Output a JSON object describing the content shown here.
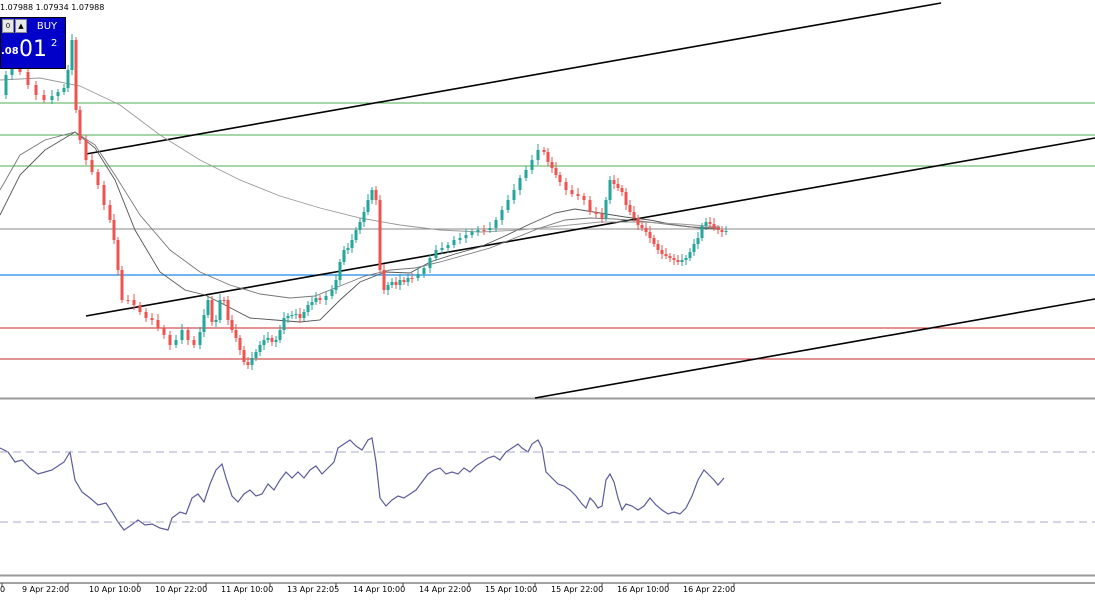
{
  "header": {
    "ohlc": "1.07988 1.07934 1.07988"
  },
  "trade_panel": {
    "small_button_left": "0",
    "small_button_right": "▲",
    "buy_label": "BUY",
    "price_prefix": ".08",
    "price_big": "01",
    "price_sup": "2"
  },
  "time_axis": {
    "labels": [
      "0",
      "9 Apr 22:00",
      "10 Apr 10:00",
      "10 Apr 22:00",
      "11 Apr 10:00",
      "13 Apr 22:05",
      "14 Apr 10:00",
      "14 Apr 22:00",
      "15 Apr 10:00",
      "15 Apr 22:00",
      "16 Apr 10:00",
      "16 Apr 22:00"
    ]
  },
  "colors": {
    "bull": "#26a69a",
    "bear": "#ef5350",
    "support_green": "#4caf50",
    "blue_level": "#1e88e5",
    "red_level": "#c62828",
    "oscillator": "#5c5c9c"
  },
  "icons": [
    "up-arrow-icon"
  ]
}
